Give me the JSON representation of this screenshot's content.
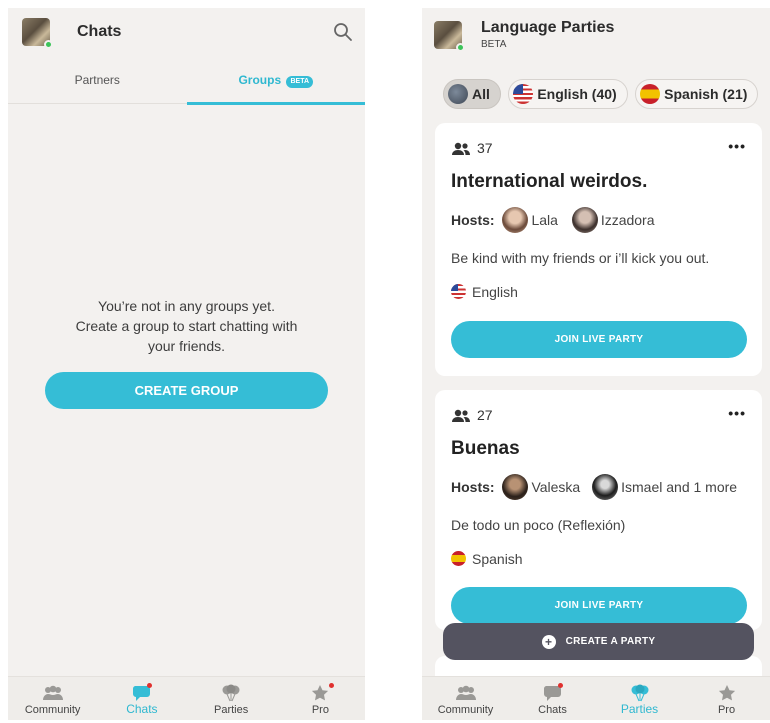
{
  "left": {
    "header": {
      "title": "Chats"
    },
    "tabs": {
      "partners": "Partners",
      "groups": "Groups",
      "groups_badge": "BETA"
    },
    "empty_state": {
      "line1": "You’re not in any groups yet.",
      "line2": "Create a group to start chatting with",
      "line3": "your friends."
    },
    "create_group_label": "CREATE GROUP",
    "nav": [
      {
        "label": "Community",
        "icon": "community-icon"
      },
      {
        "label": "Chats",
        "icon": "chats-icon",
        "active": true
      },
      {
        "label": "Parties",
        "icon": "parties-icon"
      },
      {
        "label": "Pro",
        "icon": "star-icon"
      }
    ]
  },
  "right": {
    "header": {
      "title": "Language Parties",
      "subtitle": "BETA"
    },
    "filters": [
      {
        "label": "All",
        "icon": "globe-icon",
        "active": true
      },
      {
        "label": "English (40)",
        "icon": "us-flag-icon"
      },
      {
        "label": "Spanish (21)",
        "icon": "spain-flag-icon"
      }
    ],
    "parties": [
      {
        "members": "37",
        "title": "International weirdos.",
        "hosts_label": "Hosts:",
        "host1": "Lala",
        "host2": "Izzadora",
        "description": "Be kind with my friends or i’ll kick you out.",
        "language": "English",
        "join_label": "JOIN LIVE PARTY"
      },
      {
        "members": "27",
        "title": "Buenas",
        "hosts_label": "Hosts:",
        "host1": "Valeska",
        "host2": "Ismael and 1 more",
        "description": "De todo un poco (Reflexión)",
        "language": "Spanish",
        "join_label": "JOIN LIVE PARTY"
      }
    ],
    "create_party_label": "CREATE A PARTY",
    "nav": [
      {
        "label": "Community",
        "icon": "community-icon"
      },
      {
        "label": "Chats",
        "icon": "chats-icon"
      },
      {
        "label": "Parties",
        "icon": "parties-icon",
        "active": true
      },
      {
        "label": "Pro",
        "icon": "star-icon"
      }
    ]
  },
  "colors": {
    "accent": "#35bdd6",
    "dark_button": "#545360",
    "background": "#f3f1ef",
    "online": "#3cc45a",
    "notification": "#e0302e"
  }
}
